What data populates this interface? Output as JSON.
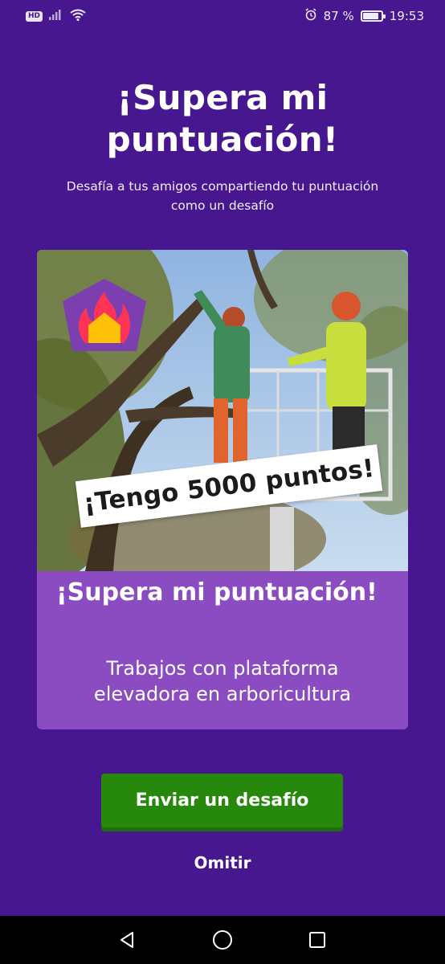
{
  "status_bar": {
    "hd": "HD",
    "battery_percent_text": "87 %",
    "battery_level": 0.87,
    "time": "19:53",
    "icons": [
      "signal-icon",
      "wifi-icon",
      "alarm-icon",
      "battery-icon"
    ]
  },
  "header": {
    "title": "¡Supera mi puntuación!",
    "subtitle": "Desafía a tus amigos compartiendo tu puntuación como un desafío"
  },
  "card": {
    "score_text": "¡Tengo 5000 puntos!",
    "title": "¡Supera mi puntuación!",
    "description": "Trabajos con plataforma elevadora en arboricultura",
    "badge_icon": "flame-badge-icon"
  },
  "actions": {
    "send_label": "Enviar un desafío",
    "skip_label": "Omitir"
  },
  "nav_bar": {
    "icons": [
      "back-icon",
      "home-icon",
      "recents-icon"
    ]
  },
  "colors": {
    "background": "#46178f",
    "card_bottom": "#8b4cc2",
    "button": "#26890c",
    "nav_bar": "#000000"
  }
}
